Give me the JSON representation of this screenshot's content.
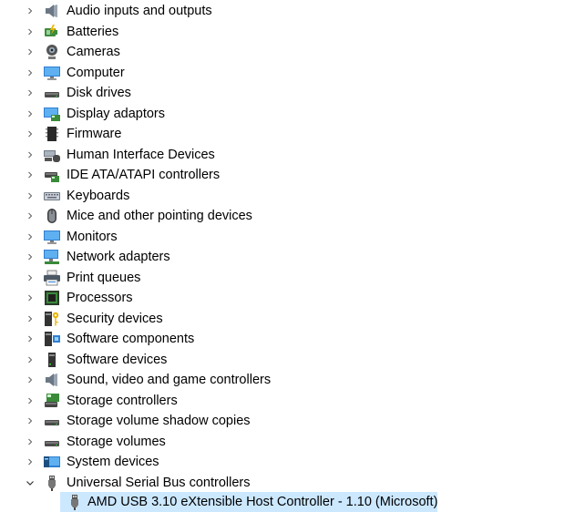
{
  "tree": {
    "categories": [
      {
        "label": "Audio inputs and outputs",
        "icon": "speaker-icon",
        "expanded": false
      },
      {
        "label": "Batteries",
        "icon": "battery-icon",
        "expanded": false
      },
      {
        "label": "Cameras",
        "icon": "camera-icon",
        "expanded": false
      },
      {
        "label": "Computer",
        "icon": "computer-icon",
        "expanded": false
      },
      {
        "label": "Disk drives",
        "icon": "disk-drive-icon",
        "expanded": false
      },
      {
        "label": "Display adaptors",
        "icon": "display-adaptor-icon",
        "expanded": false
      },
      {
        "label": "Firmware",
        "icon": "firmware-icon",
        "expanded": false
      },
      {
        "label": "Human Interface Devices",
        "icon": "hid-icon",
        "expanded": false
      },
      {
        "label": "IDE ATA/ATAPI controllers",
        "icon": "ide-controller-icon",
        "expanded": false
      },
      {
        "label": "Keyboards",
        "icon": "keyboard-icon",
        "expanded": false
      },
      {
        "label": "Mice and other pointing devices",
        "icon": "mouse-icon",
        "expanded": false
      },
      {
        "label": "Monitors",
        "icon": "monitor-icon",
        "expanded": false
      },
      {
        "label": "Network adapters",
        "icon": "network-adapter-icon",
        "expanded": false
      },
      {
        "label": "Print queues",
        "icon": "printer-icon",
        "expanded": false
      },
      {
        "label": "Processors",
        "icon": "processor-icon",
        "expanded": false
      },
      {
        "label": "Security devices",
        "icon": "security-device-icon",
        "expanded": false
      },
      {
        "label": "Software components",
        "icon": "software-component-icon",
        "expanded": false
      },
      {
        "label": "Software devices",
        "icon": "software-device-icon",
        "expanded": false
      },
      {
        "label": "Sound, video and game controllers",
        "icon": "speaker-icon",
        "expanded": false
      },
      {
        "label": "Storage controllers",
        "icon": "storage-controller-icon",
        "expanded": false
      },
      {
        "label": "Storage volume shadow copies",
        "icon": "disk-drive-icon",
        "expanded": false
      },
      {
        "label": "Storage volumes",
        "icon": "disk-drive-icon",
        "expanded": false
      },
      {
        "label": "System devices",
        "icon": "system-device-icon",
        "expanded": false
      },
      {
        "label": "Universal Serial Bus controllers",
        "icon": "usb-icon",
        "expanded": true
      }
    ],
    "selected_child": {
      "label": "AMD USB 3.10 eXtensible Host Controller - 1.10 (Microsoft)",
      "icon": "usb-icon"
    },
    "colors": {
      "selection": "#cce8ff",
      "chevron": "#666666"
    }
  }
}
